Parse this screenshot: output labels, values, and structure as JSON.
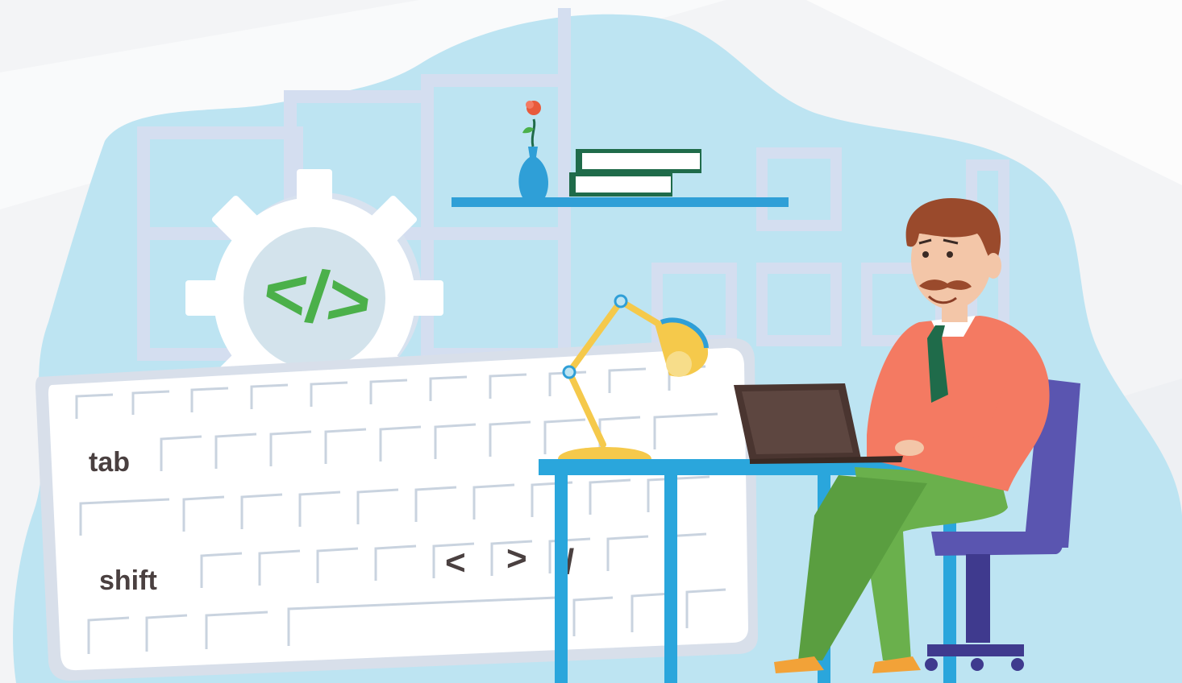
{
  "keyboard": {
    "tab_label": "tab",
    "shift_label": "shift",
    "lt_key": "<",
    "gt_key": ">",
    "slash_key": "/"
  },
  "gear": {
    "code_symbol": "</>"
  },
  "icons": {
    "gear": "gear-icon",
    "code": "code-icon",
    "lamp": "desk-lamp-icon",
    "laptop": "laptop-icon",
    "vase": "flower-vase-icon",
    "books": "books-icon"
  },
  "colors": {
    "blob": "#bde4f2",
    "window_frame": "#d4def0",
    "shelf": "#2f9fd7",
    "desk": "#2aa6dc",
    "shirt": "#f47a62",
    "pants": "#6ab04c",
    "tie": "#1f6b4a",
    "hair": "#9a4a2c",
    "chair": "#5a55b0",
    "lamp": "#f5c94b",
    "code_green": "#4bb04a"
  }
}
